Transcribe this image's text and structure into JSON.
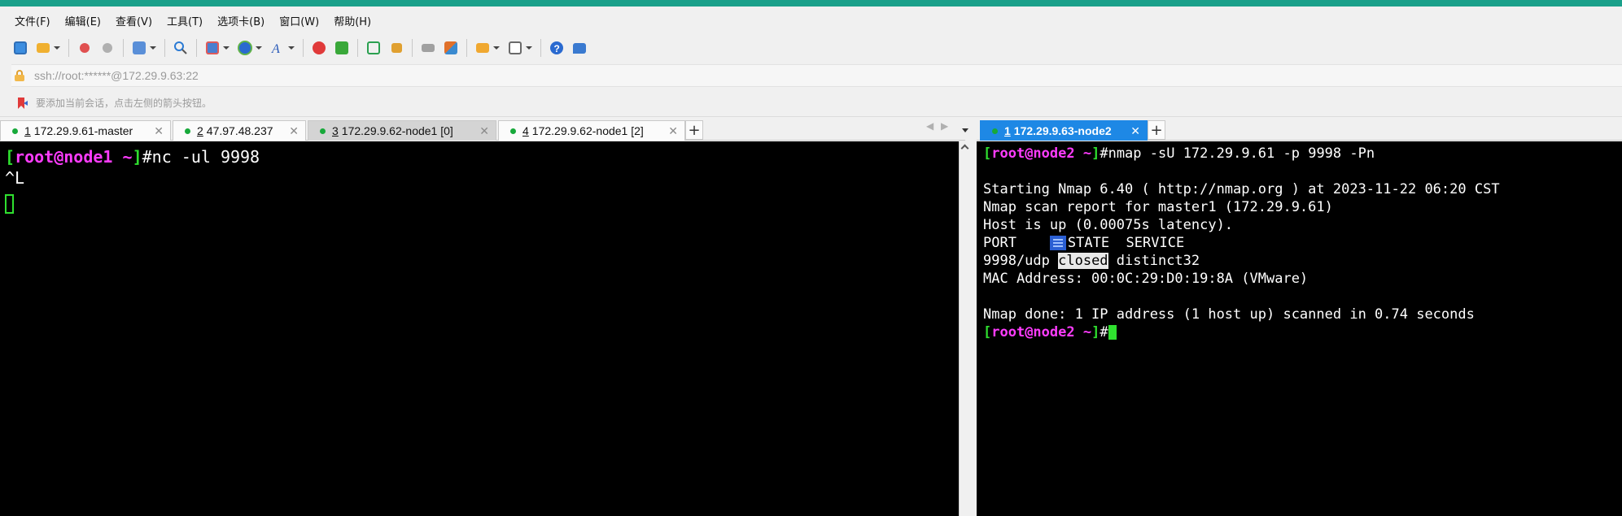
{
  "menu": [
    "文件(F)",
    "编辑(E)",
    "查看(V)",
    "工具(T)",
    "选项卡(B)",
    "窗口(W)",
    "帮助(H)"
  ],
  "toolbar_icons": [
    "new-session-icon",
    "open-folder-icon",
    "disconnect-icon",
    "reconnect-icon",
    "properties-icon",
    "find-icon",
    "transfer-icon",
    "globe-icon",
    "font-icon",
    "compose-icon",
    "xftp-icon",
    "fullscreen-icon",
    "lock-icon",
    "keyboard-icon",
    "highlight-icon",
    "add-folder-icon",
    "layout-icon",
    "help-icon",
    "chat-icon"
  ],
  "address": "ssh://root:******@172.29.9.63:22",
  "hint": "要添加当前会话，点击左侧的箭头按钮。",
  "left_tabs": [
    {
      "num": "1",
      "label": "172.29.9.61-master"
    },
    {
      "num": "2",
      "label": "47.97.48.237"
    },
    {
      "num": "3",
      "label": "172.29.9.62-node1 [0]"
    },
    {
      "num": "4",
      "label": "172.29.9.62-node1 [2]"
    }
  ],
  "right_tabs": [
    {
      "num": "1",
      "label": "172.29.9.63-node2"
    }
  ],
  "left_terminal": {
    "prompt_user": "root@node1",
    "prompt_path": " ~",
    "command": "#nc -ul 9998",
    "line2": "^L"
  },
  "right_terminal": {
    "prompt_user": "root@node2",
    "prompt_path": " ~",
    "command": "#nmap -sU 172.29.9.61 -p 9998 -Pn",
    "lines": [
      "Starting Nmap 6.40 ( http://nmap.org ) at 2023-11-22 06:20 CST",
      "Nmap scan report for master1 (172.29.9.61)",
      "Host is up (0.00075s latency)."
    ],
    "header_port": "PORT",
    "header_rest": "STATE  SERVICE",
    "row_port": "9998/udp ",
    "row_state": "closed",
    "row_service": " distinct32",
    "mac": "MAC Address: 00:0C:29:D0:19:8A (VMware)",
    "done": "Nmap done: 1 IP address (1 host up) scanned in 0.74 seconds",
    "prompt2_tail": "#"
  },
  "colors": {
    "accent": "#1aa08a",
    "active_tab": "#1e88e5",
    "prompt_green": "#2fe02f",
    "prompt_magenta": "#ff3cff"
  }
}
